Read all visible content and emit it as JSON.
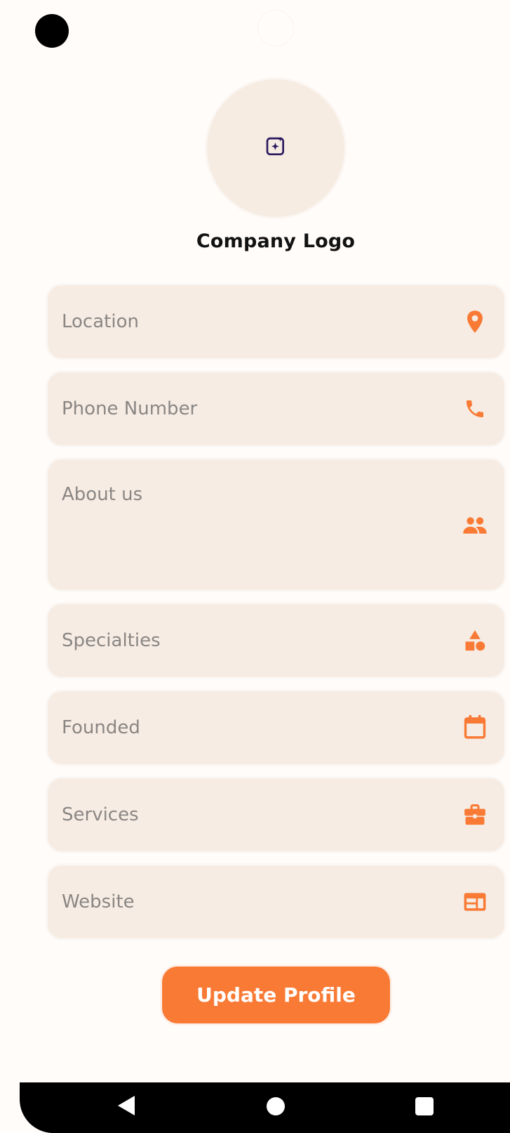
{
  "colors": {
    "accent": "#F97A35",
    "field_background": "#F6ECE3",
    "placeholder_text": "#8A8684",
    "logo_icon": "#2A1A5E"
  },
  "profile": {
    "logo_icon": "add-photo-sparkle-icon",
    "logo_label": "Company Logo"
  },
  "fields": [
    {
      "placeholder": "Location",
      "icon": "location-pin-icon"
    },
    {
      "placeholder": "Phone Number",
      "icon": "phone-icon"
    },
    {
      "placeholder": "About us",
      "icon": "people-icon"
    },
    {
      "placeholder": "Specialties",
      "icon": "shapes-icon"
    },
    {
      "placeholder": "Founded",
      "icon": "calendar-icon"
    },
    {
      "placeholder": "Services",
      "icon": "briefcase-icon"
    },
    {
      "placeholder": "Website",
      "icon": "web-window-icon"
    }
  ],
  "actions": {
    "update_label": "Update Profile"
  },
  "system_nav": {
    "back_icon": "back-triangle-icon",
    "home_icon": "home-circle-icon",
    "recents_icon": "recents-square-icon"
  }
}
